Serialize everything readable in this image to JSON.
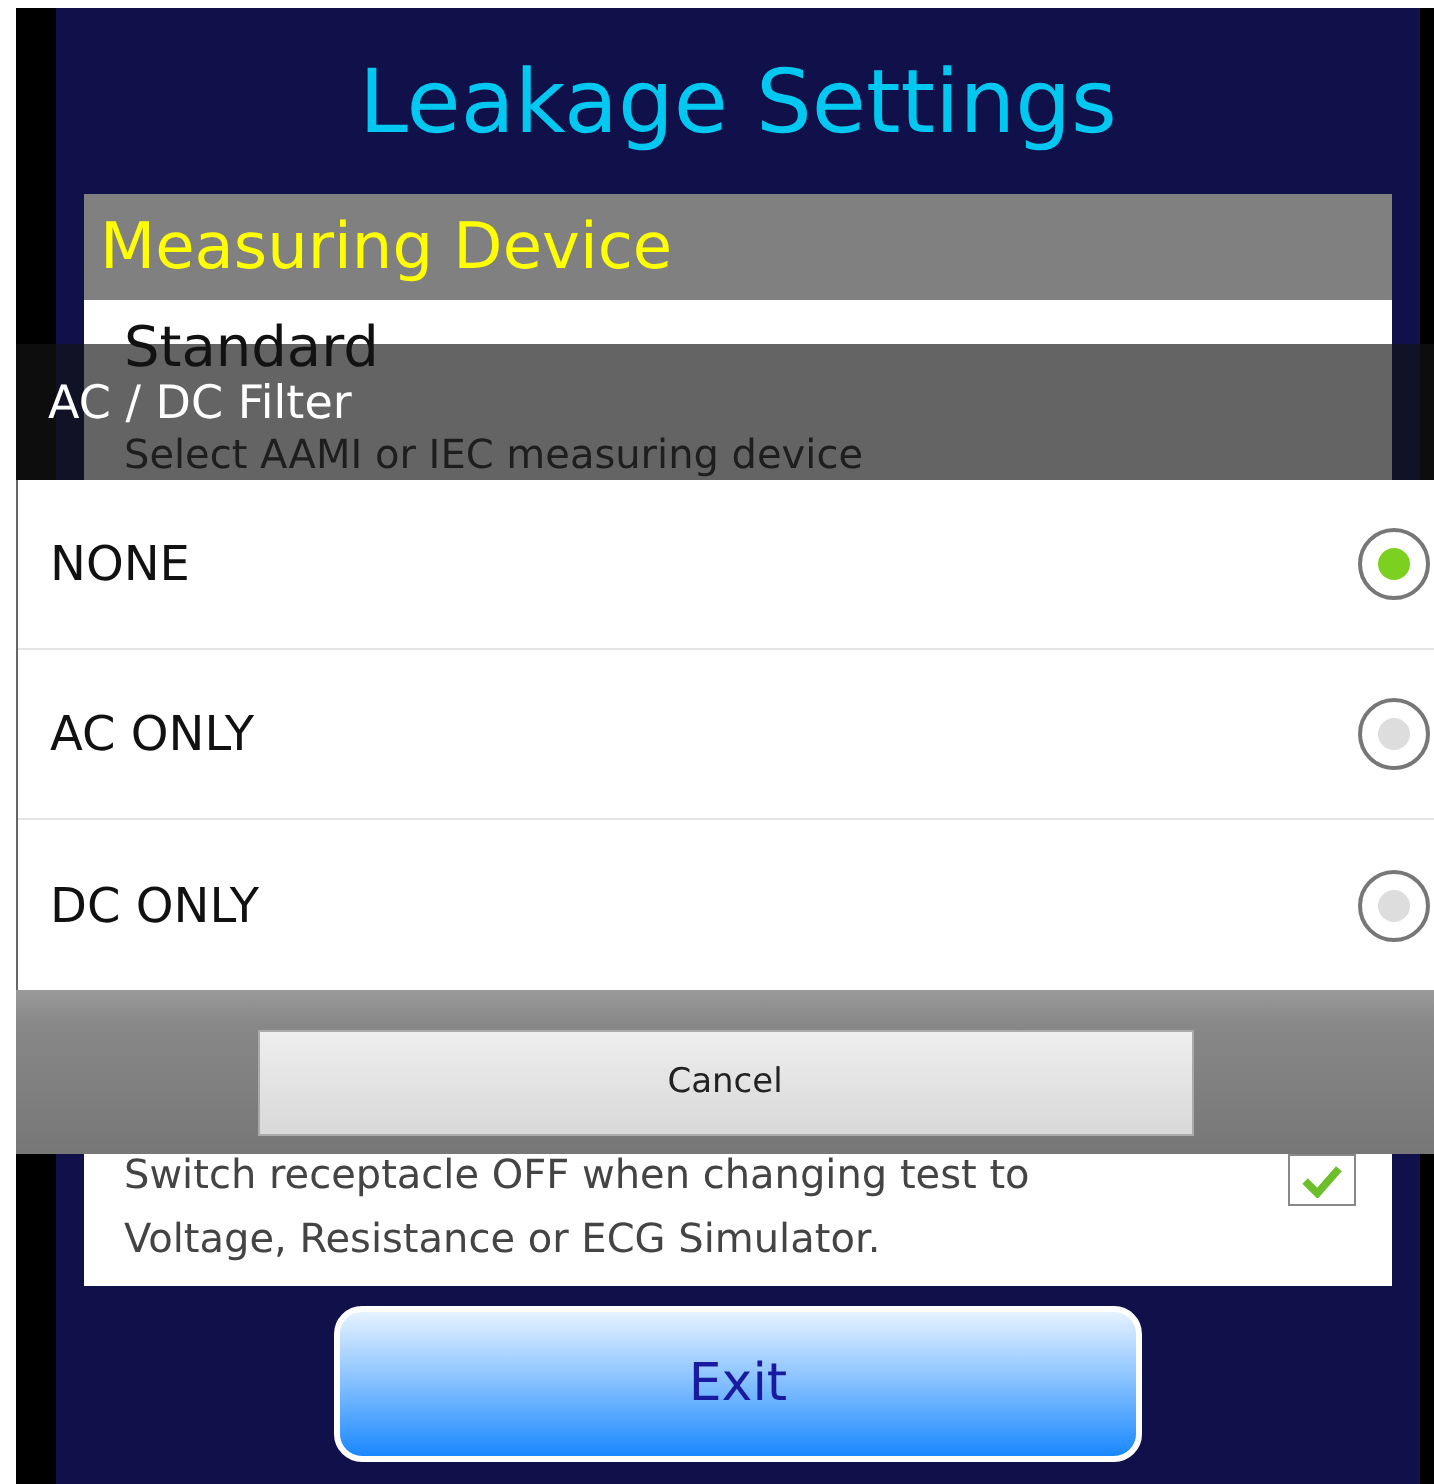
{
  "screen": {
    "title": "Leakage Settings",
    "section": "Measuring Device"
  },
  "settings": [
    {
      "kind": "text",
      "title": "Standard",
      "subtitle": "Select AAMI or IEC measuring device"
    },
    {
      "kind": "checkbox",
      "text": "Switch receptacle OFF when changing test to Voltage, Resistance or ECG Simulator.",
      "checked": true
    }
  ],
  "dialog": {
    "title": "AC / DC Filter",
    "options": [
      {
        "label": "NONE",
        "selected": true
      },
      {
        "label": "AC ONLY",
        "selected": false
      },
      {
        "label": "DC ONLY",
        "selected": false
      }
    ],
    "cancel": "Cancel"
  },
  "exit_button": "Exit"
}
